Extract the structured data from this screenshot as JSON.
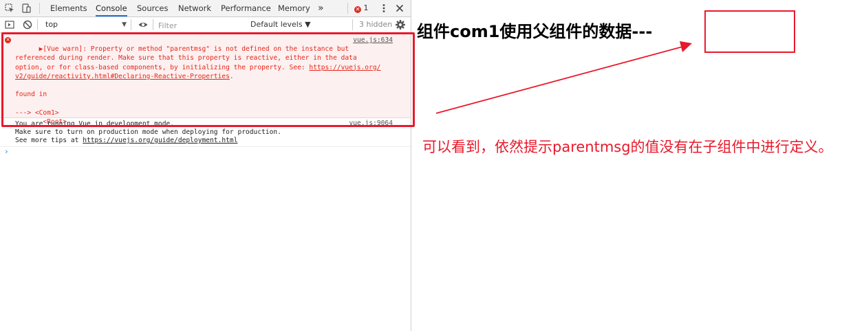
{
  "devtools": {
    "tabs": [
      {
        "label": "Elements"
      },
      {
        "label": "Console"
      },
      {
        "label": "Sources"
      },
      {
        "label": "Network"
      },
      {
        "label": "Performance"
      },
      {
        "label": "Memory"
      }
    ],
    "more_tabs": "»",
    "error_count": "1",
    "toolbar": {
      "context": "top",
      "filter_placeholder": "Filter",
      "levels": "Default levels ▼",
      "hidden": "3 hidden"
    },
    "messages": {
      "error": {
        "text": "▶[Vue warn]: Property or method \"parentmsg\" is not defined on the instance but\nreferenced during render. Make sure that this property is reactive, either in the data\noption, or for class-based components, by initializing the property. See: ",
        "link1": "https://vuejs.org/",
        "link2": "v2/guide/reactivity.html#Declaring-Reactive-Properties",
        "link_end": ".",
        "tail": "\n\nfound in\n\n---> <Com1>\n       <Root>",
        "source": "vue.js:634"
      },
      "info": {
        "line1": "You are running Vue in development mode.",
        "line2": "Make sure to turn on production mode when deploying for production.",
        "line3_prefix": "See more tips at ",
        "line3_link": "https://vuejs.org/guide/deployment.html",
        "source": "vue.js:9064"
      }
    },
    "prompt": "›"
  },
  "annotation": {
    "title": "组件com1使用父组件的数据---",
    "note": "可以看到，依然提示parentmsg的值没有在子组件中进行定义。",
    "accent_color": "#e8192b"
  }
}
